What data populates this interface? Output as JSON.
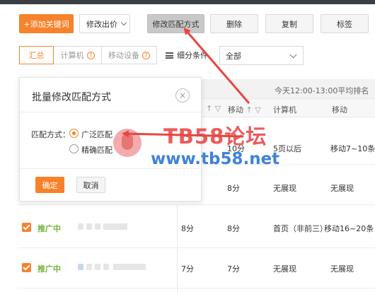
{
  "toolbar": {
    "add_keyword": "+添加关键词",
    "modify_bid": "修改出价",
    "modify_match": "修改匹配方式",
    "delete": "删除",
    "copy": "复制",
    "tag": "标签"
  },
  "tabs": [
    {
      "label": "汇总"
    },
    {
      "label": "计算机"
    },
    {
      "label": "移动设备"
    }
  ],
  "filter": {
    "label": "细分条件",
    "value": "全部"
  },
  "table": {
    "group_header": "今天12:00-13:00平均排名",
    "col_mobile": "移动",
    "col_computer": "计算机",
    "col_mobile2": "移动",
    "rows": [
      {
        "status": "",
        "score1": "",
        "score2": "10分",
        "pc_rank": "5页以后",
        "mobile_rank": "移动7~10条"
      },
      {
        "status": "",
        "score1": "",
        "score2": "8分",
        "pc_rank": "无展现",
        "mobile_rank": "无展现"
      },
      {
        "status": "推广中",
        "score1": "8分",
        "score2": "8分",
        "pc_rank": "首页（非前三）",
        "mobile_rank": "移动16~20条"
      },
      {
        "status": "推广中",
        "score1": "7分",
        "score2": "7分",
        "pc_rank": "无展现",
        "mobile_rank": "无展现"
      }
    ]
  },
  "dialog": {
    "title": "批量修改匹配方式",
    "close": "×",
    "match_label": "匹配方式：",
    "option_broad": "广泛匹配",
    "option_exact": "精确匹配",
    "confirm": "确定",
    "cancel": "取消"
  },
  "watermark": {
    "line1": "TB58论坛",
    "line2": "www.tb58.net"
  },
  "colors": {
    "accent": "#f7822b",
    "promo_green": "#6fb33a",
    "watermark_red": "#ec5b5b",
    "watermark_blue": "#3f82d8",
    "arrow_red": "#e8463f"
  }
}
